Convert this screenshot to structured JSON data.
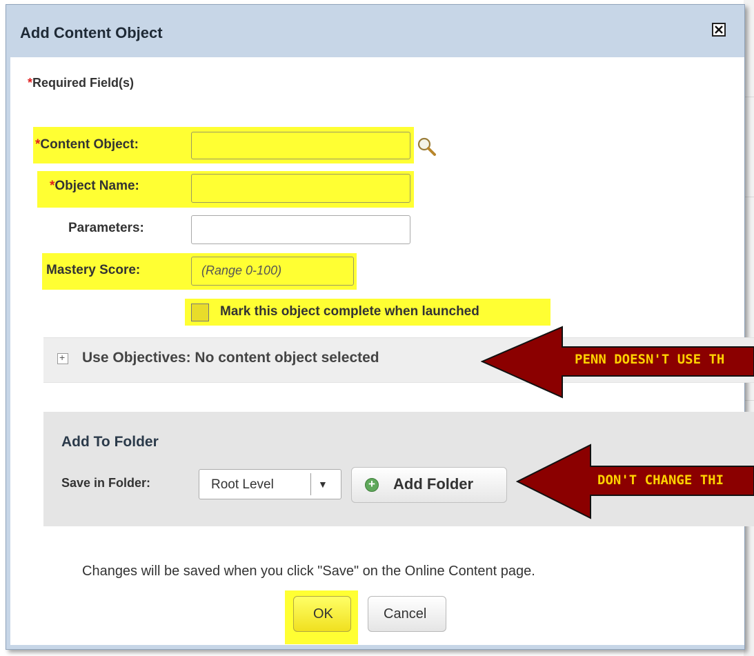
{
  "dialog": {
    "title": "Add Content Object",
    "required_star": "*",
    "required_note": "Required Field(s)"
  },
  "form": {
    "content_object_label": "Content Object:",
    "object_name_label": "Object Name:",
    "parameters_label": "Parameters:",
    "mastery_score_label": "Mastery Score:",
    "mastery_score_placeholder": "(Range 0-100)",
    "mark_complete_label": "Mark this object complete when launched",
    "content_object_value": "",
    "object_name_value": "",
    "parameters_value": ""
  },
  "objectives": {
    "text": "Use Objectives: No content object selected",
    "expand_glyph": "+"
  },
  "folder": {
    "heading": "Add To Folder",
    "save_in_label": "Save in Folder:",
    "selected": "Root Level",
    "add_folder_label": "Add Folder"
  },
  "footer": {
    "note": "Changes will be saved when you click \"Save\" on the Online Content page.",
    "ok_label": "OK",
    "cancel_label": "Cancel"
  },
  "callouts": {
    "objectives_note": "PENN DOESN'T USE TH",
    "folder_note": "DON'T CHANGE THI",
    "color": "#8b0000",
    "text_color": "#ffd200"
  },
  "colors": {
    "highlight": "#ffff33",
    "dialog_frame": "#c7d6e7",
    "required": "#e02020"
  }
}
